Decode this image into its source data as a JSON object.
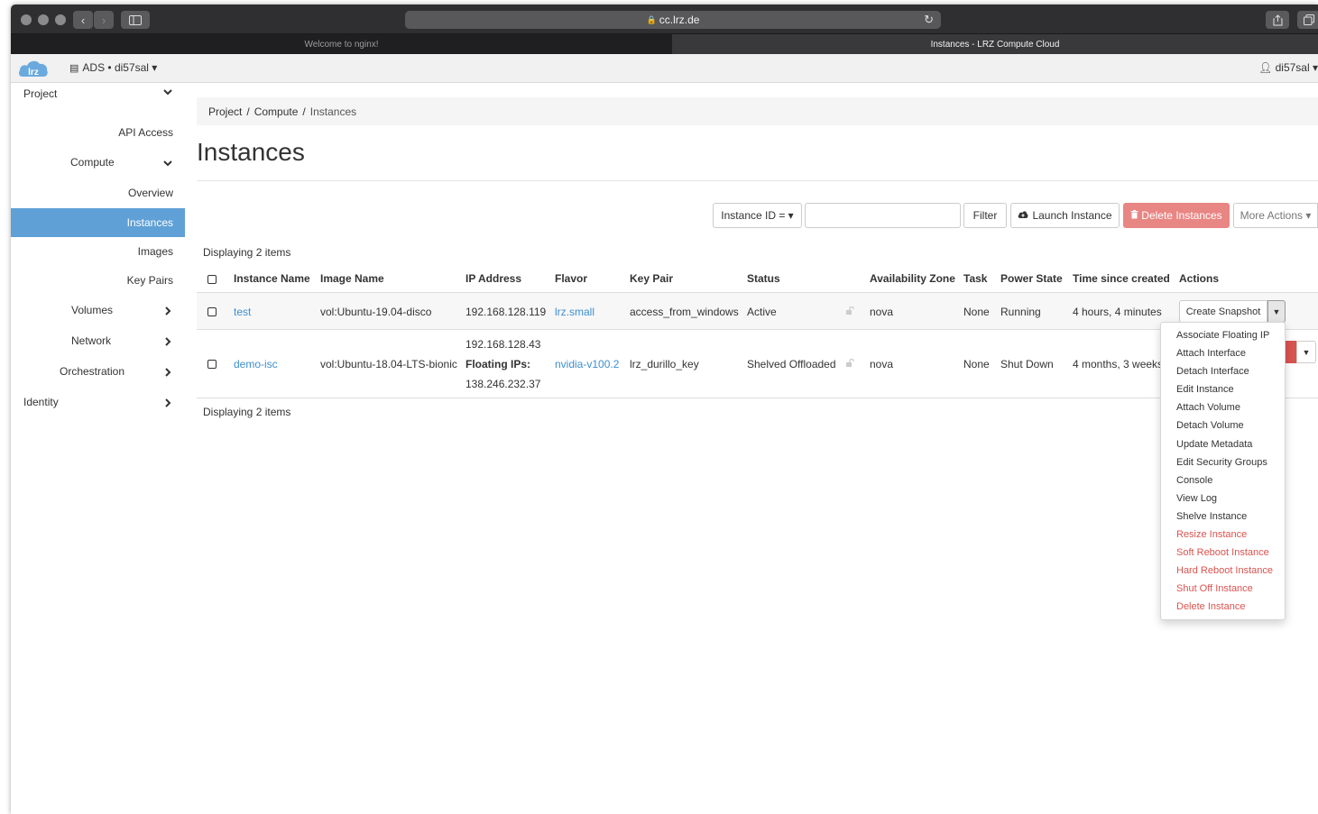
{
  "browser": {
    "url": "cc.lrz.de",
    "tabs": [
      {
        "title": "Welcome to nginx!",
        "active": false
      },
      {
        "title": "Instances - LRZ Compute Cloud",
        "active": true
      }
    ]
  },
  "header": {
    "logo_text": "lrz",
    "project": "ADS • di57sal ▾",
    "user": "di57sal ▾"
  },
  "sidebar": {
    "project": "Project",
    "api_access": "API Access",
    "compute": "Compute",
    "overview": "Overview",
    "instances": "Instances",
    "images": "Images",
    "key_pairs": "Key Pairs",
    "volumes": "Volumes",
    "network": "Network",
    "orchestration": "Orchestration",
    "identity": "Identity"
  },
  "breadcrumb": [
    "Project",
    "Compute",
    "Instances"
  ],
  "page_title": "Instances",
  "toolbar": {
    "filter_field": "Instance ID = ▾",
    "filter_value": "",
    "filter": "Filter",
    "launch": "Launch Instance",
    "delete": "Delete Instances",
    "more": "More Actions ▾"
  },
  "display_count": "Displaying 2 items",
  "table": {
    "columns": [
      "Instance Name",
      "Image Name",
      "IP Address",
      "Flavor",
      "Key Pair",
      "Status",
      "Availability Zone",
      "Task",
      "Power State",
      "Time since created",
      "Actions"
    ],
    "rows": [
      {
        "name": "test",
        "image": "vol:Ubuntu-19.04-disco",
        "ip": "192.168.128.119",
        "flavor": "lrz.small",
        "key_pair": "access_from_windows",
        "status": "Active",
        "az": "nova",
        "task": "None",
        "power": "Running",
        "time": "4 hours, 4 minutes",
        "action": "Create Snapshot"
      },
      {
        "name": "demo-isc",
        "image": "vol:Ubuntu-18.04-LTS-bionic",
        "ip": "192.168.128.43",
        "floating_label": "Floating IPs:",
        "floating_ip": "138.246.232.37",
        "flavor": "nvidia-v100.2",
        "key_pair": "lrz_durillo_key",
        "status": "Shelved Offloaded",
        "az": "nova",
        "task": "None",
        "power": "Shut Down",
        "time": "4 months, 3 weeks"
      }
    ]
  },
  "dropdown": [
    {
      "label": "Associate Floating IP",
      "danger": false
    },
    {
      "label": "Attach Interface",
      "danger": false
    },
    {
      "label": "Detach Interface",
      "danger": false
    },
    {
      "label": "Edit Instance",
      "danger": false
    },
    {
      "label": "Attach Volume",
      "danger": false
    },
    {
      "label": "Detach Volume",
      "danger": false
    },
    {
      "label": "Update Metadata",
      "danger": false
    },
    {
      "label": "Edit Security Groups",
      "danger": false
    },
    {
      "label": "Console",
      "danger": false
    },
    {
      "label": "View Log",
      "danger": false
    },
    {
      "label": "Shelve Instance",
      "danger": false
    },
    {
      "label": "Resize Instance",
      "danger": true
    },
    {
      "label": "Soft Reboot Instance",
      "danger": true
    },
    {
      "label": "Hard Reboot Instance",
      "danger": true
    },
    {
      "label": "Shut Off Instance",
      "danger": true
    },
    {
      "label": "Delete Instance",
      "danger": true
    }
  ],
  "colors": {
    "accent": "#5fa0d6",
    "link": "#3d8fd1",
    "danger": "#d9534f"
  }
}
